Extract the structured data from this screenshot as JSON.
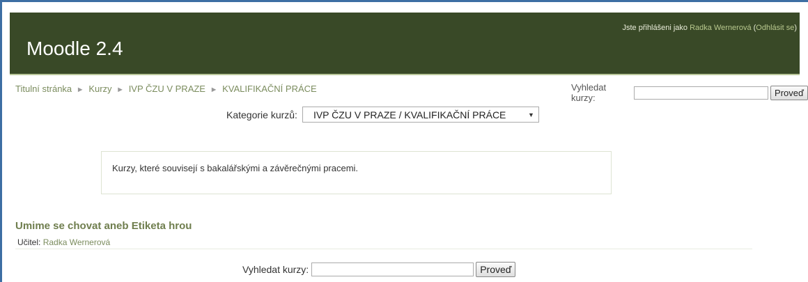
{
  "header": {
    "site_title": "Moodle 2.4",
    "login_prefix": "Jste přihlášeni jako",
    "user_name": "Radka Wernerová",
    "logout_open": "(",
    "logout_label": "Odhlásit se",
    "logout_close": ")"
  },
  "breadcrumb": {
    "items": [
      "Titulní stránka",
      "Kurzy",
      "IVP ČZU V PRAZE",
      "KVALIFIKAČNÍ PRÁCE"
    ],
    "separator": "►"
  },
  "search_top": {
    "label": "Vyhledat kurzy:",
    "value": "",
    "button": "Proveď"
  },
  "category": {
    "label": "Kategorie kurzů:",
    "selected": "IVP ČZU V PRAZE / KVALIFIKAČNÍ PRÁCE",
    "caret_icon": "caret-down-icon"
  },
  "description": "Kurzy, které souvisejí s bakalářskými a závěrečnými pracemi.",
  "course": {
    "title": "Umime se chovat aneb Etiketa hrou",
    "teacher_label": "Učitel:",
    "teacher_name": "Radka Wernerová"
  },
  "search_bottom": {
    "label": "Vyhledat kurzy:",
    "value": "",
    "button": "Proveď"
  },
  "colors": {
    "header_bg": "#394927",
    "link": "#7b8c5e",
    "frame": "#3d6ea3"
  }
}
